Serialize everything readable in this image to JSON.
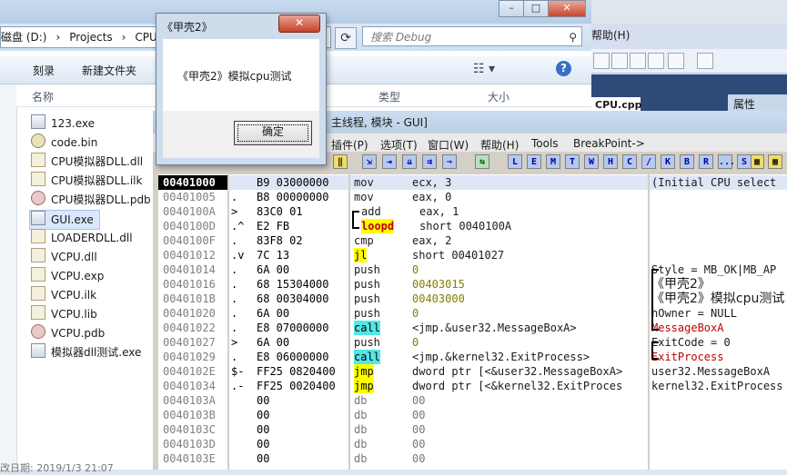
{
  "explorer": {
    "title_fragment": "CPU模",
    "address": [
      "磁盘 (D:)",
      "›",
      "Projects",
      "›",
      "CPU模"
    ],
    "search_placeholder": "搜索 Debug",
    "cmd_burn": "刻录",
    "cmd_newfolder": "新建文件夹",
    "col_name": "名称",
    "col_type": "类型",
    "col_size": "大小",
    "files": [
      {
        "name": "123.exe",
        "kind": "exe"
      },
      {
        "name": "code.bin",
        "kind": "bin"
      },
      {
        "name": "CPU模拟器DLL.dll",
        "kind": "dll"
      },
      {
        "name": "CPU模拟器DLL.ilk",
        "kind": "dll"
      },
      {
        "name": "CPU模拟器DLL.pdb",
        "kind": "pdb"
      },
      {
        "name": "GUI.exe",
        "kind": "exe"
      },
      {
        "name": "LOADERDLL.dll",
        "kind": "dll"
      },
      {
        "name": "VCPU.dll",
        "kind": "dll"
      },
      {
        "name": "VCPU.exp",
        "kind": "dll"
      },
      {
        "name": "VCPU.ilk",
        "kind": "dll"
      },
      {
        "name": "VCPU.lib",
        "kind": "dll"
      },
      {
        "name": "VCPU.pdb",
        "kind": "pdb"
      },
      {
        "name": "模拟器dll测试.exe",
        "kind": "exe"
      }
    ],
    "selected_file": "GUI.exe",
    "status_partial": "改日期: 2019/1/3 21:07"
  },
  "ide": {
    "menu_help": "帮助(H)",
    "tab_file": "CPU.cpp",
    "tab_props": "属性"
  },
  "olly": {
    "title": "主线程, 模块 - GUI]",
    "menu": [
      "插件(P)",
      "选项(T)",
      "窗口(W)",
      "帮助(H)",
      "Tools",
      "BreakPoint->"
    ],
    "toolbar_letters": [
      "L",
      "E",
      "M",
      "T",
      "W",
      "H",
      "C",
      "/",
      "K",
      "B",
      "R",
      "...",
      "S"
    ],
    "rows": [
      {
        "addr": "00401000",
        "mark": "",
        "hex": "B9 03000000",
        "mn": "mov",
        "op": "ecx, 3",
        "cur": true
      },
      {
        "addr": "00401005",
        "mark": ".",
        "hex": "B8 00000000",
        "mn": "mov",
        "op": "eax, 0"
      },
      {
        "addr": "0040100A",
        "mark": ">",
        "hex": "83C0 01",
        "mn": "add",
        "op": "eax, 1"
      },
      {
        "addr": "0040100D",
        "mark": ".^",
        "hex": "E2 FB",
        "mn": "loopd",
        "op": "short 0040100A"
      },
      {
        "addr": "0040100F",
        "mark": ".",
        "hex": "83F8 02",
        "mn": "cmp",
        "op": "eax, 2"
      },
      {
        "addr": "00401012",
        "mark": ".v",
        "hex": "7C 13",
        "mn": "jl",
        "op": "short 00401027"
      },
      {
        "addr": "00401014",
        "mark": ".",
        "hex": "6A 00",
        "mn": "push",
        "op": "0"
      },
      {
        "addr": "00401016",
        "mark": ".",
        "hex": "68 15304000",
        "mn": "push",
        "op": "00403015"
      },
      {
        "addr": "0040101B",
        "mark": ".",
        "hex": "68 00304000",
        "mn": "push",
        "op": "00403000"
      },
      {
        "addr": "00401020",
        "mark": ".",
        "hex": "6A 00",
        "mn": "push",
        "op": "0"
      },
      {
        "addr": "00401022",
        "mark": ".",
        "hex": "E8 07000000",
        "mn": "call",
        "op": "<jmp.&user32.MessageBoxA>"
      },
      {
        "addr": "00401027",
        "mark": ">",
        "hex": "6A 00",
        "mn": "push",
        "op": "0"
      },
      {
        "addr": "00401029",
        "mark": ".",
        "hex": "E8 06000000",
        "mn": "call",
        "op": "<jmp.&kernel32.ExitProcess>"
      },
      {
        "addr": "0040102E",
        "mark": "$-",
        "hex": "FF25 0820400",
        "mn": "jmp",
        "op": "dword ptr [<&user32.MessageBoxA>"
      },
      {
        "addr": "00401034",
        "mark": ".-",
        "hex": "FF25 0020400",
        "mn": "jmp",
        "op": "dword ptr [<&kernel32.ExitProces"
      },
      {
        "addr": "0040103A",
        "mark": "",
        "hex": "00",
        "mn": "db",
        "op": "00"
      },
      {
        "addr": "0040103B",
        "mark": "",
        "hex": "00",
        "mn": "db",
        "op": "00"
      },
      {
        "addr": "0040103C",
        "mark": "",
        "hex": "00",
        "mn": "db",
        "op": "00"
      },
      {
        "addr": "0040103D",
        "mark": "",
        "hex": "00",
        "mn": "db",
        "op": "00"
      },
      {
        "addr": "0040103E",
        "mark": "",
        "hex": "00",
        "mn": "db",
        "op": "00"
      }
    ],
    "comments": {
      "r0": "(Initial CPU select",
      "r6": "Style = MB_OK|MB_AP",
      "r7": "《甲壳2》",
      "r8": "《甲壳2》模拟cpu测试",
      "r9": "hOwner = NULL",
      "r10": "MessageBoxA",
      "r11": "ExitCode = 0",
      "r12": "ExitProcess",
      "r13": "user32.MessageBoxA",
      "r14": "kernel32.ExitProcess"
    }
  },
  "msgbox": {
    "title": "《甲壳2》",
    "close": "✕",
    "text": "《甲壳2》模拟cpu测试",
    "ok": "确定"
  }
}
